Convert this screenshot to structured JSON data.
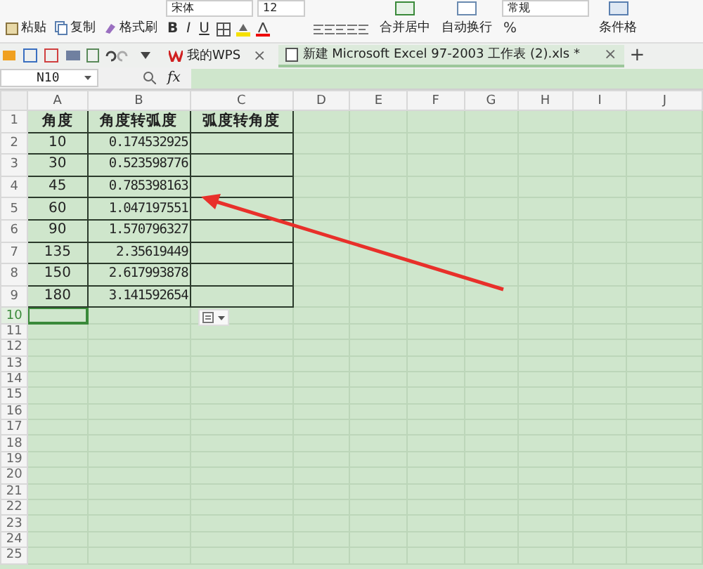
{
  "ribbon": {
    "clipboard": [
      {
        "label": "粘贴",
        "kind": "paste"
      },
      {
        "label": "复制",
        "kind": "copy"
      },
      {
        "label": "格式刷",
        "kind": "brush"
      }
    ],
    "font": "宋体",
    "size": "12",
    "styles": [
      "B",
      "I",
      "U"
    ],
    "merge": "合并居中",
    "wrap": "自动换行",
    "number_format": "常规",
    "percent": "%",
    "conditional": "条件格"
  },
  "tabs": [
    {
      "label": "我的WPS",
      "selected": false,
      "close": "×"
    },
    {
      "label": "新建 Microsoft Excel 97-2003 工作表 (2).xls *",
      "selected": true,
      "close": "×"
    }
  ],
  "new_tab": "+",
  "formula_bar": {
    "name_box": "N10",
    "fx": "fx"
  },
  "columns": [
    "A",
    "B",
    "C",
    "D",
    "E",
    "F",
    "G",
    "H",
    "I",
    "J"
  ],
  "rows": [
    {
      "number": "1",
      "selected": false,
      "cells": [
        "角度",
        "角度转弧度",
        "弧度转角度"
      ]
    },
    {
      "number": "2",
      "selected": false,
      "cells": [
        "10",
        "0.174532925"
      ]
    },
    {
      "number": "3",
      "selected": false,
      "cells": [
        "30",
        "0.523598776"
      ]
    },
    {
      "number": "4",
      "selected": false,
      "cells": [
        "45",
        "0.785398163"
      ]
    },
    {
      "number": "5",
      "selected": false,
      "cells": [
        "60",
        "1.047197551"
      ]
    },
    {
      "number": "6",
      "selected": false,
      "cells": [
        "90",
        "1.570796327"
      ]
    },
    {
      "number": "7",
      "selected": false,
      "cells": [
        "135",
        "2.35619449"
      ]
    },
    {
      "number": "8",
      "selected": false,
      "cells": [
        "150",
        "2.617993878"
      ]
    },
    {
      "number": "9",
      "selected": false,
      "cells": [
        "180",
        "3.141592654"
      ]
    },
    {
      "number": "10",
      "selected": true,
      "cells": []
    },
    {
      "number": "11",
      "selected": false,
      "cells": []
    },
    {
      "number": "12",
      "selected": false,
      "cells": []
    },
    {
      "number": "13",
      "selected": false,
      "cells": []
    },
    {
      "number": "14",
      "selected": false,
      "cells": []
    },
    {
      "number": "15",
      "selected": false,
      "cells": []
    },
    {
      "number": "16",
      "selected": false,
      "cells": []
    },
    {
      "number": "17",
      "selected": false,
      "cells": []
    },
    {
      "number": "18",
      "selected": false,
      "cells": []
    },
    {
      "number": "19",
      "selected": false,
      "cells": []
    },
    {
      "number": "20",
      "selected": false,
      "cells": []
    },
    {
      "number": "21",
      "selected": false,
      "cells": []
    },
    {
      "number": "22",
      "selected": false,
      "cells": []
    },
    {
      "number": "23",
      "selected": false,
      "cells": []
    },
    {
      "number": "24",
      "selected": false,
      "cells": []
    },
    {
      "number": "25",
      "selected": false,
      "cells": []
    }
  ]
}
